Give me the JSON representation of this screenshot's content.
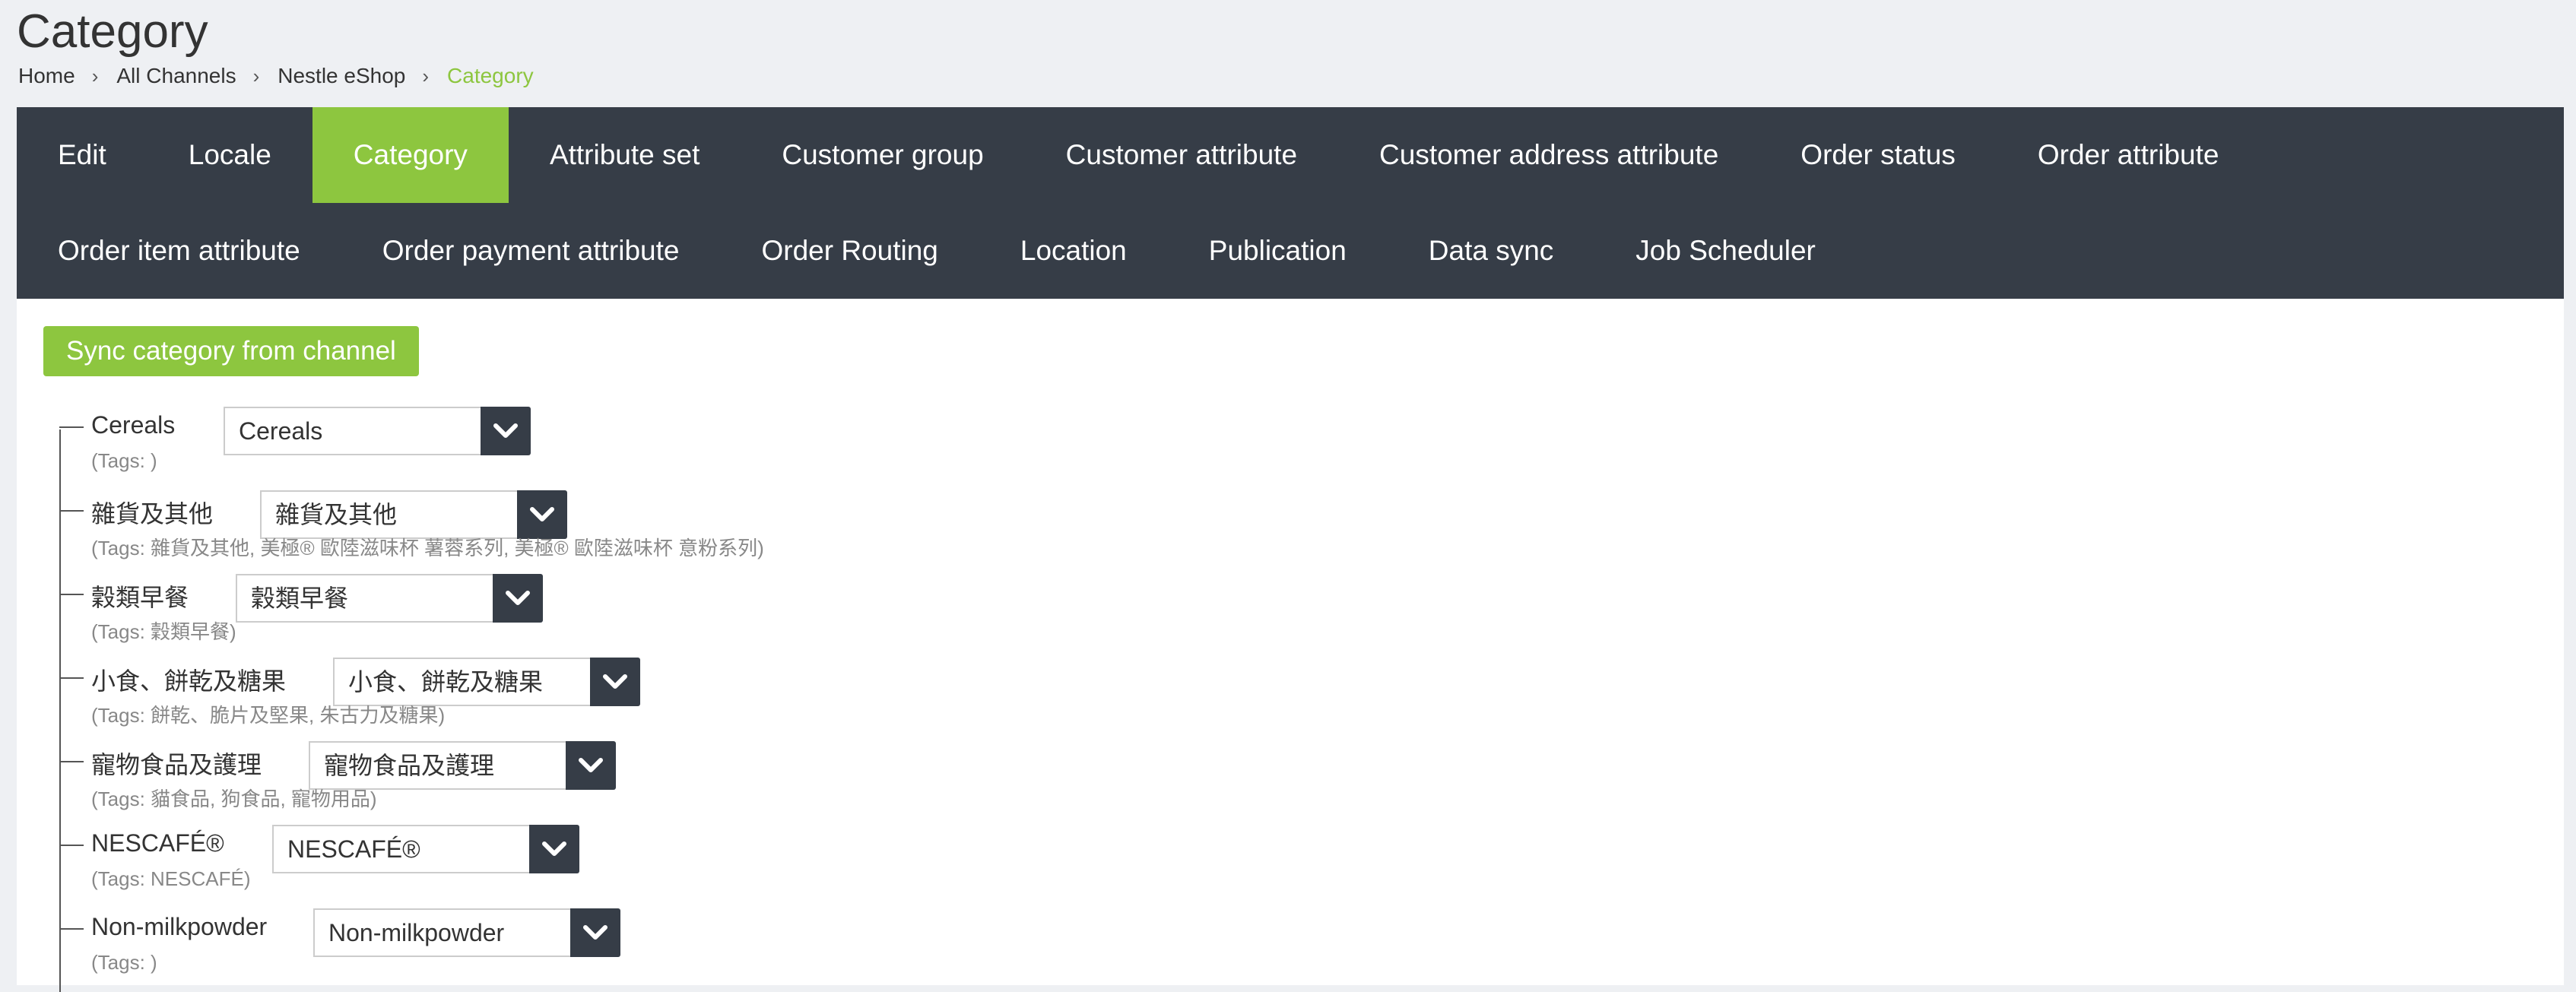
{
  "page": {
    "title": "Category"
  },
  "breadcrumb": [
    "Home",
    "All Channels",
    "Nestle eShop",
    "Category"
  ],
  "tabs": {
    "row1": [
      "Edit",
      "Locale",
      "Category",
      "Attribute set",
      "Customer group",
      "Customer attribute",
      "Customer address attribute",
      "Order status",
      "Order attribute"
    ],
    "row2": [
      "Order item attribute",
      "Order payment attribute",
      "Order Routing",
      "Location",
      "Publication",
      "Data sync",
      "Job Scheduler"
    ],
    "active": "Category"
  },
  "sync_button": "Sync category from channel",
  "categories": [
    {
      "name": "Cereals",
      "selected": "Cereals",
      "tags": "(Tags: )"
    },
    {
      "name": "雜貨及其他",
      "selected": "雜貨及其他",
      "tags": "(Tags: 雜貨及其他, 美極® 歐陸滋味杯 薯蓉系列, 美極® 歐陸滋味杯 意粉系列)"
    },
    {
      "name": "穀類早餐",
      "selected": "穀類早餐",
      "tags": "(Tags: 穀類早餐)"
    },
    {
      "name": "小食、餅乾及糖果",
      "selected": "小食、餅乾及糖果",
      "tags": "(Tags: 餅乾、脆片及堅果, 朱古力及糖果)"
    },
    {
      "name": "寵物食品及護理",
      "selected": "寵物食品及護理",
      "tags": "(Tags: 貓食品, 狗食品, 寵物用品)"
    },
    {
      "name": "NESCAFÉ®",
      "selected": "NESCAFÉ®",
      "tags": "(Tags: NESCAFÉ)"
    },
    {
      "name": "Non-milkpowder",
      "selected": "Non-milkpowder",
      "tags": "(Tags: )"
    }
  ],
  "colors": {
    "accent": "#8dc63f",
    "dark": "#363d47",
    "background": "#eef0f3"
  }
}
